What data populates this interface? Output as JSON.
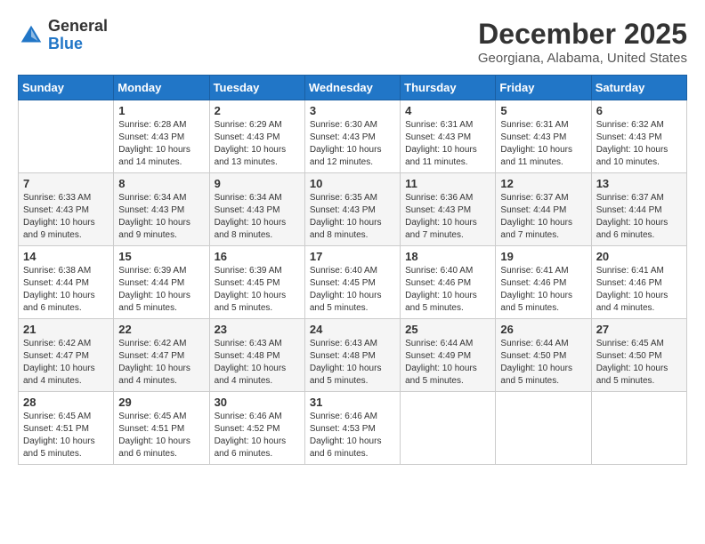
{
  "logo": {
    "general": "General",
    "blue": "Blue"
  },
  "header": {
    "title": "December 2025",
    "subtitle": "Georgiana, Alabama, United States"
  },
  "weekdays": [
    "Sunday",
    "Monday",
    "Tuesday",
    "Wednesday",
    "Thursday",
    "Friday",
    "Saturday"
  ],
  "weeks": [
    [
      {
        "day": "",
        "info": ""
      },
      {
        "day": "1",
        "info": "Sunrise: 6:28 AM\nSunset: 4:43 PM\nDaylight: 10 hours\nand 14 minutes."
      },
      {
        "day": "2",
        "info": "Sunrise: 6:29 AM\nSunset: 4:43 PM\nDaylight: 10 hours\nand 13 minutes."
      },
      {
        "day": "3",
        "info": "Sunrise: 6:30 AM\nSunset: 4:43 PM\nDaylight: 10 hours\nand 12 minutes."
      },
      {
        "day": "4",
        "info": "Sunrise: 6:31 AM\nSunset: 4:43 PM\nDaylight: 10 hours\nand 11 minutes."
      },
      {
        "day": "5",
        "info": "Sunrise: 6:31 AM\nSunset: 4:43 PM\nDaylight: 10 hours\nand 11 minutes."
      },
      {
        "day": "6",
        "info": "Sunrise: 6:32 AM\nSunset: 4:43 PM\nDaylight: 10 hours\nand 10 minutes."
      }
    ],
    [
      {
        "day": "7",
        "info": "Sunrise: 6:33 AM\nSunset: 4:43 PM\nDaylight: 10 hours\nand 9 minutes."
      },
      {
        "day": "8",
        "info": "Sunrise: 6:34 AM\nSunset: 4:43 PM\nDaylight: 10 hours\nand 9 minutes."
      },
      {
        "day": "9",
        "info": "Sunrise: 6:34 AM\nSunset: 4:43 PM\nDaylight: 10 hours\nand 8 minutes."
      },
      {
        "day": "10",
        "info": "Sunrise: 6:35 AM\nSunset: 4:43 PM\nDaylight: 10 hours\nand 8 minutes."
      },
      {
        "day": "11",
        "info": "Sunrise: 6:36 AM\nSunset: 4:43 PM\nDaylight: 10 hours\nand 7 minutes."
      },
      {
        "day": "12",
        "info": "Sunrise: 6:37 AM\nSunset: 4:44 PM\nDaylight: 10 hours\nand 7 minutes."
      },
      {
        "day": "13",
        "info": "Sunrise: 6:37 AM\nSunset: 4:44 PM\nDaylight: 10 hours\nand 6 minutes."
      }
    ],
    [
      {
        "day": "14",
        "info": "Sunrise: 6:38 AM\nSunset: 4:44 PM\nDaylight: 10 hours\nand 6 minutes."
      },
      {
        "day": "15",
        "info": "Sunrise: 6:39 AM\nSunset: 4:44 PM\nDaylight: 10 hours\nand 5 minutes."
      },
      {
        "day": "16",
        "info": "Sunrise: 6:39 AM\nSunset: 4:45 PM\nDaylight: 10 hours\nand 5 minutes."
      },
      {
        "day": "17",
        "info": "Sunrise: 6:40 AM\nSunset: 4:45 PM\nDaylight: 10 hours\nand 5 minutes."
      },
      {
        "day": "18",
        "info": "Sunrise: 6:40 AM\nSunset: 4:46 PM\nDaylight: 10 hours\nand 5 minutes."
      },
      {
        "day": "19",
        "info": "Sunrise: 6:41 AM\nSunset: 4:46 PM\nDaylight: 10 hours\nand 5 minutes."
      },
      {
        "day": "20",
        "info": "Sunrise: 6:41 AM\nSunset: 4:46 PM\nDaylight: 10 hours\nand 4 minutes."
      }
    ],
    [
      {
        "day": "21",
        "info": "Sunrise: 6:42 AM\nSunset: 4:47 PM\nDaylight: 10 hours\nand 4 minutes."
      },
      {
        "day": "22",
        "info": "Sunrise: 6:42 AM\nSunset: 4:47 PM\nDaylight: 10 hours\nand 4 minutes."
      },
      {
        "day": "23",
        "info": "Sunrise: 6:43 AM\nSunset: 4:48 PM\nDaylight: 10 hours\nand 4 minutes."
      },
      {
        "day": "24",
        "info": "Sunrise: 6:43 AM\nSunset: 4:48 PM\nDaylight: 10 hours\nand 5 minutes."
      },
      {
        "day": "25",
        "info": "Sunrise: 6:44 AM\nSunset: 4:49 PM\nDaylight: 10 hours\nand 5 minutes."
      },
      {
        "day": "26",
        "info": "Sunrise: 6:44 AM\nSunset: 4:50 PM\nDaylight: 10 hours\nand 5 minutes."
      },
      {
        "day": "27",
        "info": "Sunrise: 6:45 AM\nSunset: 4:50 PM\nDaylight: 10 hours\nand 5 minutes."
      }
    ],
    [
      {
        "day": "28",
        "info": "Sunrise: 6:45 AM\nSunset: 4:51 PM\nDaylight: 10 hours\nand 5 minutes."
      },
      {
        "day": "29",
        "info": "Sunrise: 6:45 AM\nSunset: 4:51 PM\nDaylight: 10 hours\nand 6 minutes."
      },
      {
        "day": "30",
        "info": "Sunrise: 6:46 AM\nSunset: 4:52 PM\nDaylight: 10 hours\nand 6 minutes."
      },
      {
        "day": "31",
        "info": "Sunrise: 6:46 AM\nSunset: 4:53 PM\nDaylight: 10 hours\nand 6 minutes."
      },
      {
        "day": "",
        "info": ""
      },
      {
        "day": "",
        "info": ""
      },
      {
        "day": "",
        "info": ""
      }
    ]
  ]
}
